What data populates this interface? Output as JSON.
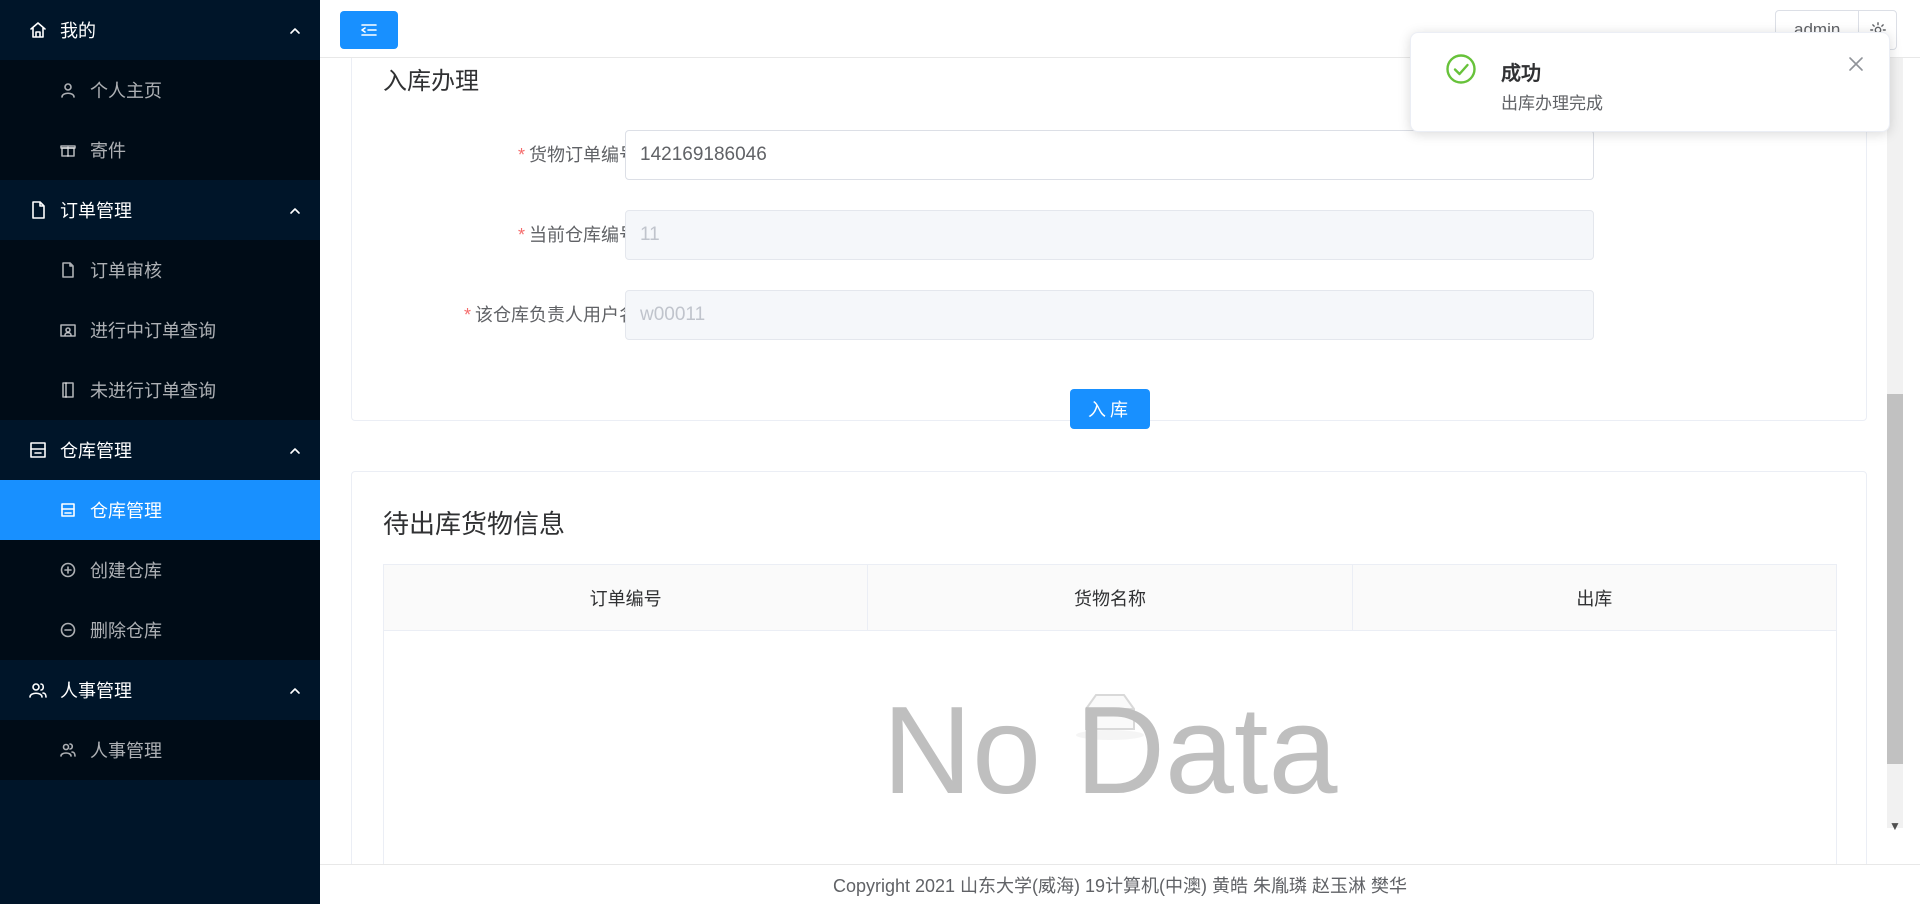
{
  "sidebar": {
    "groups": [
      {
        "label": "我的",
        "items": [
          "个人主页",
          "寄件"
        ]
      },
      {
        "label": "订单管理",
        "items": [
          "订单审核",
          "进行中订单查询",
          "未进行订单查询"
        ]
      },
      {
        "label": "仓库管理",
        "items": [
          "仓库管理",
          "创建仓库",
          "删除仓库"
        ]
      },
      {
        "label": "人事管理",
        "items": [
          "人事管理"
        ]
      }
    ],
    "active_item": "仓库管理",
    "colors": {
      "background": "#001529",
      "submenu_background": "#000c17",
      "active": "#1890ff"
    }
  },
  "header": {
    "username": "admin"
  },
  "inbound_form": {
    "title": "入库办理",
    "fields": [
      {
        "label": "货物订单编号",
        "value": "142169186046",
        "disabled": false
      },
      {
        "label": "当前仓库编号",
        "value": "11",
        "disabled": true
      },
      {
        "label": "该仓库负责人用户名",
        "value": "w00011",
        "disabled": true
      }
    ],
    "colon": ":",
    "submit_label": "入库"
  },
  "outbound_table": {
    "title": "待出库货物信息",
    "columns": [
      "订单编号",
      "货物名称",
      "出库"
    ],
    "empty_text": "No Data"
  },
  "footer": {
    "text": "Copyright 2021 山东大学(威海) 19计算机(中澳) 黄皓 朱胤璘 赵玉淋 樊华"
  },
  "notification": {
    "title": "成功",
    "message": "出库办理完成",
    "status_color": "#67c23a"
  }
}
